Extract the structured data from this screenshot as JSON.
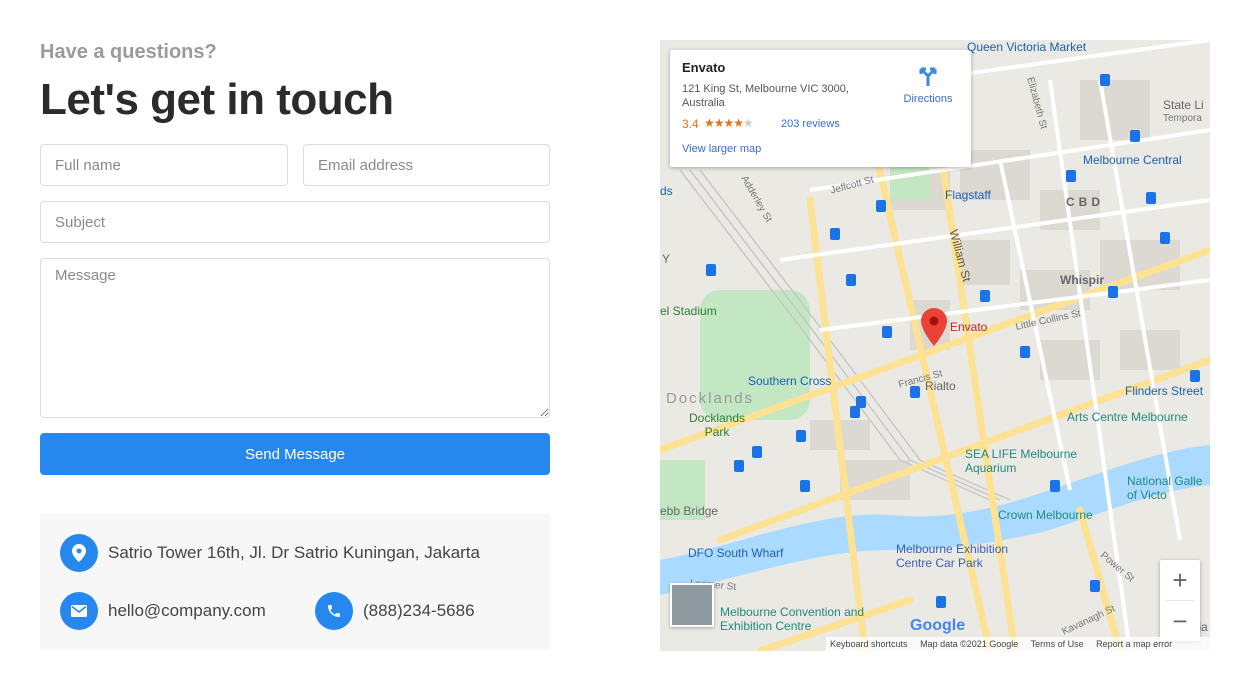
{
  "form": {
    "eyebrow": "Have a questions?",
    "heading": "Let's get in touch",
    "full_name_placeholder": "Full name",
    "email_placeholder": "Email address",
    "subject_placeholder": "Subject",
    "message_placeholder": "Message",
    "submit_label": "Send Message"
  },
  "contact": {
    "address": "Satrio Tower 16th, Jl. Dr Satrio Kuningan, Jakarta",
    "email": "hello@company.com",
    "phone": "(888)234-5686"
  },
  "map": {
    "place_name": "Envato",
    "place_address": "121 King St, Melbourne VIC 3000, Australia",
    "rating": "3.4",
    "rating_value": 3.4,
    "reviews": "203 reviews",
    "view_larger": "View larger map",
    "directions": "Directions",
    "pin_label": "Envato",
    "labels": {
      "queen_victoria": "Queen Victoria Market",
      "elizabeth": "Elizabeth St",
      "state_library": "State Li",
      "temporary": "Tempora",
      "melbourne_central": "Melbourne Central",
      "flagstaff": "Flagstaff",
      "cbd": "CBD",
      "jeffcott": "Jeffcott St",
      "adderley": "Adderley St",
      "william": "William St",
      "whispir": "Whispir",
      "little_collins": "Little Collins St",
      "stadium": "el Stadium",
      "southern_cross": "Southern Cross",
      "rialto": "Rialto",
      "francis": "Francis St",
      "docklands": "Docklands",
      "docklands_park": "Docklands Park",
      "flinders": "Flinders Street",
      "arts_centre": "Arts Centre Melbourne",
      "sea_life": "SEA LIFE Melbourne Aquarium",
      "national_gallery": "National Galle of Victo",
      "crown": "Crown Melbourne",
      "webb_bridge": "ebb Bridge",
      "dfo": "DFO South Wharf",
      "exhibition_car_park": "Melbourne Exhibition Centre Car Park",
      "convention": "Melbourne Convention and Exhibition Centre",
      "lorimer": "Lorimer St",
      "power": "Power St",
      "kavanagh": "Kavanagh St",
      "victoria": "Victoria",
      "y": "Y",
      "ds": "ds"
    },
    "zoom_in": "+",
    "zoom_out": "−",
    "logo": "Google",
    "footer": {
      "shortcuts": "Keyboard shortcuts",
      "data": "Map data ©2021 Google",
      "terms": "Terms of Use",
      "report": "Report a map error"
    },
    "colors": {
      "primary": "#2687ee",
      "water": "#aadaff",
      "park": "#c3e6c3",
      "road": "#fde293",
      "pin": "#ea4335"
    }
  }
}
